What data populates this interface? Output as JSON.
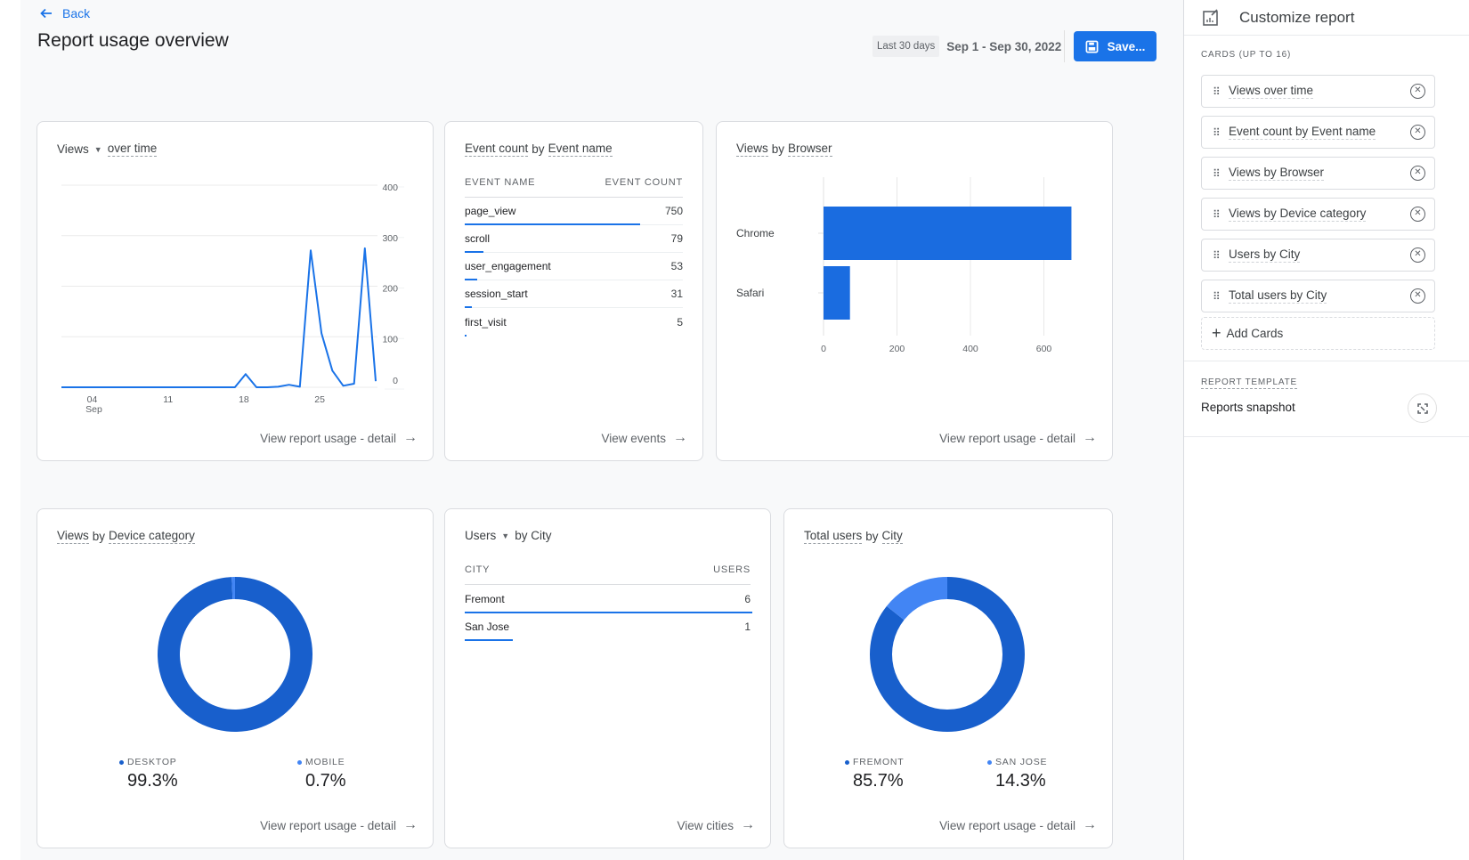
{
  "header": {
    "back_label": "Back",
    "title": "Report usage overview",
    "date_chip": "Last 30 days",
    "date_range": "Sep 1 - Sep 30, 2022",
    "save_label": "Save..."
  },
  "colors": {
    "accent": "#1a73e8",
    "donut_primary": "#185fcc",
    "donut_secondary": "#4285f4"
  },
  "cards": {
    "views_over_time": {
      "title_metric": "Views",
      "title_rest": "over time",
      "link": "View report usage - detail"
    },
    "event_count": {
      "title_a": "Event count",
      "title_b": "by",
      "title_c": "Event name",
      "col_name": "EVENT NAME",
      "col_value": "EVENT COUNT",
      "rows": [
        {
          "name": "page_view",
          "value": "750",
          "fraction": 1.0
        },
        {
          "name": "scroll",
          "value": "79",
          "fraction": 0.105
        },
        {
          "name": "user_engagement",
          "value": "53",
          "fraction": 0.071
        },
        {
          "name": "session_start",
          "value": "31",
          "fraction": 0.041
        },
        {
          "name": "first_visit",
          "value": "5",
          "fraction": 0.007
        }
      ],
      "link": "View events"
    },
    "views_by_browser": {
      "title_a": "Views",
      "title_b": "by",
      "title_c": "Browser",
      "link": "View report usage - detail"
    },
    "views_by_device": {
      "title_a": "Views",
      "title_b": "by",
      "title_c": "Device category",
      "legend": [
        {
          "label": "DESKTOP",
          "pct": "99.3%"
        },
        {
          "label": "MOBILE",
          "pct": "0.7%"
        }
      ],
      "link": "View report usage - detail"
    },
    "users_by_city": {
      "title_metric": "Users",
      "title_rest": "by City",
      "col_name": "CITY",
      "col_value": "USERS",
      "rows": [
        {
          "name": "Fremont",
          "value": "6",
          "fraction": 1.0
        },
        {
          "name": "San Jose",
          "value": "1",
          "fraction": 0.167
        }
      ],
      "link": "View cities"
    },
    "total_users_by_city": {
      "title_a": "Total users",
      "title_b": "by",
      "title_c": "City",
      "legend": [
        {
          "label": "FREMONT",
          "pct": "85.7%"
        },
        {
          "label": "SAN JOSE",
          "pct": "14.3%"
        }
      ],
      "link": "View report usage - detail"
    }
  },
  "sidebar": {
    "title": "Customize report",
    "cards_section": "CARDS (UP TO 16)",
    "items": [
      {
        "label": "Views  over time"
      },
      {
        "label": "Event count by Event name"
      },
      {
        "label": "Views by Browser"
      },
      {
        "label": "Views by Device category"
      },
      {
        "label": "Users by City"
      },
      {
        "label": "Total users by City"
      }
    ],
    "add_label": "Add Cards",
    "template_section": "REPORT TEMPLATE",
    "template_name": "Reports snapshot"
  },
  "chart_data": [
    {
      "type": "line",
      "title": "Views over time",
      "x": [
        "Sep 1",
        "Sep 2",
        "Sep 3",
        "Sep 4",
        "Sep 5",
        "Sep 6",
        "Sep 7",
        "Sep 8",
        "Sep 9",
        "Sep 10",
        "Sep 11",
        "Sep 12",
        "Sep 13",
        "Sep 14",
        "Sep 15",
        "Sep 16",
        "Sep 17",
        "Sep 18",
        "Sep 19",
        "Sep 20",
        "Sep 21",
        "Sep 22",
        "Sep 23",
        "Sep 24",
        "Sep 25",
        "Sep 26",
        "Sep 27",
        "Sep 28",
        "Sep 29",
        "Sep 30"
      ],
      "series": [
        {
          "name": "Views",
          "values": [
            0,
            0,
            0,
            0,
            0,
            0,
            0,
            0,
            0,
            0,
            0,
            0,
            0,
            0,
            0,
            0,
            0,
            26,
            0,
            0,
            1,
            5,
            1,
            271,
            107,
            33,
            3,
            7,
            275,
            12
          ]
        }
      ],
      "xtick_labels": [
        {
          "day": 4,
          "label": "04",
          "sub": "Sep"
        },
        {
          "day": 11,
          "label": "11"
        },
        {
          "day": 18,
          "label": "18"
        },
        {
          "day": 25,
          "label": "25"
        }
      ],
      "yticks": [
        0,
        100,
        200,
        300,
        400
      ],
      "ylim": [
        0,
        400
      ],
      "yaxis_side": "right",
      "grid": true
    },
    {
      "type": "bar",
      "orientation": "horizontal",
      "title": "Views by Browser",
      "categories": [
        "Chrome",
        "Safari"
      ],
      "values": [
        675,
        72
      ],
      "xticks": [
        0,
        200,
        400,
        600
      ],
      "xlim": [
        0,
        700
      ],
      "grid": true
    },
    {
      "type": "pie",
      "title": "Views by Device category",
      "categories": [
        "DESKTOP",
        "MOBILE"
      ],
      "values": [
        99.3,
        0.7
      ],
      "donut": true
    },
    {
      "type": "pie",
      "title": "Total users by City",
      "categories": [
        "FREMONT",
        "SAN JOSE"
      ],
      "values": [
        85.7,
        14.3
      ],
      "donut": true
    }
  ]
}
